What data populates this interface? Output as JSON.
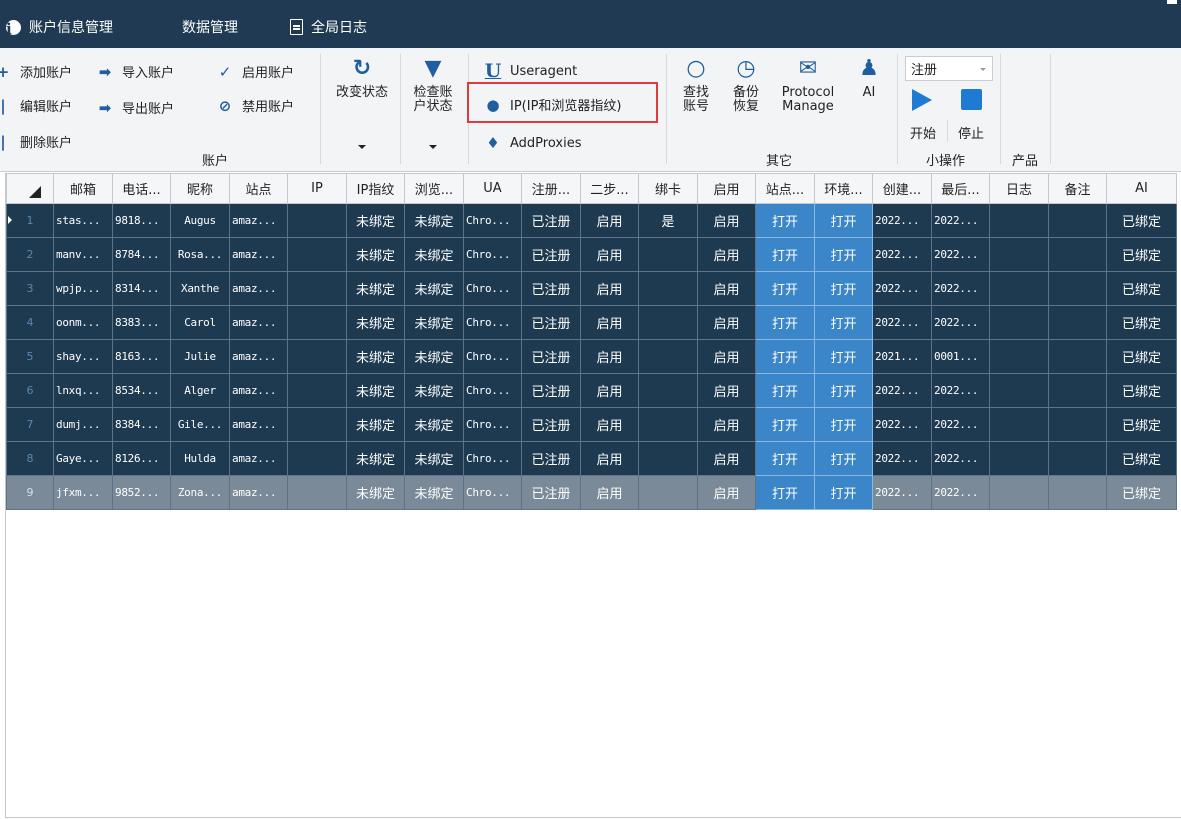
{
  "menu": {
    "items": [
      {
        "label": "账户信息管理",
        "icon": "info-icon"
      },
      {
        "label": "数据管理",
        "icon": "grid-icon"
      },
      {
        "label": "全局日志",
        "icon": "document-icon"
      }
    ]
  },
  "ribbon": {
    "account": {
      "add": "添加账户",
      "import": "导入账户",
      "enable": "启用账户",
      "edit": "编辑账户",
      "export": "导出账户",
      "disable": "禁用账户",
      "delete": "删除账户",
      "group_label": "账户"
    },
    "change_status": "改变状态",
    "check_status_line1": "检查账",
    "check_status_line2": "户状态",
    "useragent": "Useragent",
    "ip_fingerprint": "IP(IP和浏览器指纹)",
    "add_proxies": "AddProxies",
    "find_account_line1": "查找",
    "find_account_line2": "账号",
    "backup_line1": "备份",
    "backup_line2": "恢复",
    "protocol_line1": "Protocol",
    "protocol_line2": "Manage",
    "ai": "AI",
    "other_label": "其它",
    "combo_value": "注册",
    "start": "开始",
    "stop": "停止",
    "small_ops_label": "小操作",
    "product_label": "产品"
  },
  "grid": {
    "columns": [
      "邮箱",
      "电话...",
      "昵称",
      "站点",
      "IP",
      "IP指纹",
      "浏览...",
      "UA",
      "注册...",
      "二步...",
      "绑卡",
      "启用",
      "站点...",
      "环境...",
      "创建...",
      "最后...",
      "日志",
      "备注",
      "AI"
    ],
    "rows": [
      {
        "n": "1",
        "email": "stas...",
        "phone": "9818...",
        "nick": "Augus",
        "site": "amaz...",
        "ip": "",
        "fp": "未绑定",
        "browser": "未绑定",
        "ua": "Chro...",
        "reg": "已注册",
        "twostep": "启用",
        "card": "是",
        "enabled": "启用",
        "sitebtn": "打开",
        "envbtn": "打开",
        "created": "2022...",
        "last": "2022...",
        "log": "",
        "note": "",
        "ai": "已绑定"
      },
      {
        "n": "2",
        "email": "manv...",
        "phone": "8784...",
        "nick": "Rosa...",
        "site": "amaz...",
        "ip": "",
        "fp": "未绑定",
        "browser": "未绑定",
        "ua": "Chro...",
        "reg": "已注册",
        "twostep": "启用",
        "card": "",
        "enabled": "启用",
        "sitebtn": "打开",
        "envbtn": "打开",
        "created": "2022...",
        "last": "2022...",
        "log": "",
        "note": "",
        "ai": "已绑定"
      },
      {
        "n": "3",
        "email": "wpjp...",
        "phone": "8314...",
        "nick": "Xanthe",
        "site": "amaz...",
        "ip": "",
        "fp": "未绑定",
        "browser": "未绑定",
        "ua": "Chro...",
        "reg": "已注册",
        "twostep": "启用",
        "card": "",
        "enabled": "启用",
        "sitebtn": "打开",
        "envbtn": "打开",
        "created": "2022...",
        "last": "2022...",
        "log": "",
        "note": "",
        "ai": "已绑定"
      },
      {
        "n": "4",
        "email": "oonm...",
        "phone": "8383...",
        "nick": "Carol",
        "site": "amaz...",
        "ip": "",
        "fp": "未绑定",
        "browser": "未绑定",
        "ua": "Chro...",
        "reg": "已注册",
        "twostep": "启用",
        "card": "",
        "enabled": "启用",
        "sitebtn": "打开",
        "envbtn": "打开",
        "created": "2022...",
        "last": "2022...",
        "log": "",
        "note": "",
        "ai": "已绑定"
      },
      {
        "n": "5",
        "email": "shay...",
        "phone": "8163...",
        "nick": "Julie",
        "site": "amaz...",
        "ip": "",
        "fp": "未绑定",
        "browser": "未绑定",
        "ua": "Chro...",
        "reg": "已注册",
        "twostep": "启用",
        "card": "",
        "enabled": "启用",
        "sitebtn": "打开",
        "envbtn": "打开",
        "created": "2021...",
        "last": "0001...",
        "log": "",
        "note": "",
        "ai": "已绑定"
      },
      {
        "n": "6",
        "email": "lnxq...",
        "phone": "8534...",
        "nick": "Alger",
        "site": "amaz...",
        "ip": "",
        "fp": "未绑定",
        "browser": "未绑定",
        "ua": "Chro...",
        "reg": "已注册",
        "twostep": "启用",
        "card": "",
        "enabled": "启用",
        "sitebtn": "打开",
        "envbtn": "打开",
        "created": "2022...",
        "last": "2022...",
        "log": "",
        "note": "",
        "ai": "已绑定"
      },
      {
        "n": "7",
        "email": "dumj...",
        "phone": "8384...",
        "nick": "Gile...",
        "site": "amaz...",
        "ip": "",
        "fp": "未绑定",
        "browser": "未绑定",
        "ua": "Chro...",
        "reg": "已注册",
        "twostep": "启用",
        "card": "",
        "enabled": "启用",
        "sitebtn": "打开",
        "envbtn": "打开",
        "created": "2022...",
        "last": "2022...",
        "log": "",
        "note": "",
        "ai": "已绑定"
      },
      {
        "n": "8",
        "email": "Gaye...",
        "phone": "8126...",
        "nick": "Hulda",
        "site": "amaz...",
        "ip": "",
        "fp": "未绑定",
        "browser": "未绑定",
        "ua": "Chro...",
        "reg": "已注册",
        "twostep": "启用",
        "card": "",
        "enabled": "启用",
        "sitebtn": "打开",
        "envbtn": "打开",
        "created": "2022...",
        "last": "2022...",
        "log": "",
        "note": "",
        "ai": "已绑定"
      },
      {
        "n": "9",
        "email": "jfxm...",
        "phone": "9852...",
        "nick": "Zona...",
        "site": "amaz...",
        "ip": "",
        "fp": "未绑定",
        "browser": "未绑定",
        "ua": "Chro...",
        "reg": "已注册",
        "twostep": "启用",
        "card": "",
        "enabled": "启用",
        "sitebtn": "打开",
        "envbtn": "打开",
        "created": "2022...",
        "last": "2022...",
        "log": "",
        "note": "",
        "ai": "已绑定"
      }
    ]
  }
}
